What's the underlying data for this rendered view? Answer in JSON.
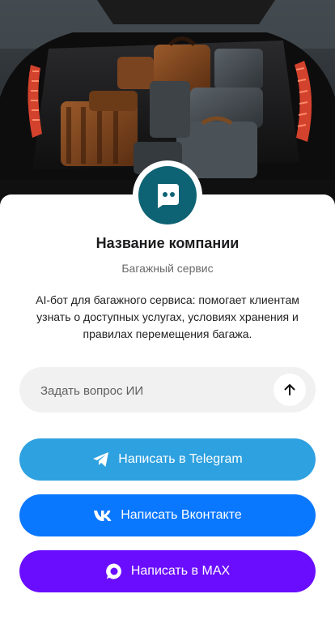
{
  "hero": {
    "image": "car-trunk-with-luggage"
  },
  "company": {
    "name": "Название компании",
    "subtitle": "Багажный сервис",
    "description": "AI-бот для багажного сервиса: помогает клиентам узнать о доступных услугах, условиях хранения и правилах перемещения багажа."
  },
  "ask": {
    "placeholder": "Задать вопрос ИИ",
    "send_icon": "arrow-up-icon"
  },
  "buttons": {
    "telegram": {
      "label": "Написать в Telegram",
      "icon": "telegram-icon",
      "color": "#2ea1e0"
    },
    "vk": {
      "label": "Написать Вконтакте",
      "icon": "vk-icon",
      "color": "#0a77ff"
    },
    "max": {
      "label": "Написать в MAX",
      "icon": "max-icon",
      "color": "#6a0dff"
    }
  },
  "colors": {
    "avatar_bg": "#0d6373",
    "ask_bg": "#f1f1f1"
  }
}
